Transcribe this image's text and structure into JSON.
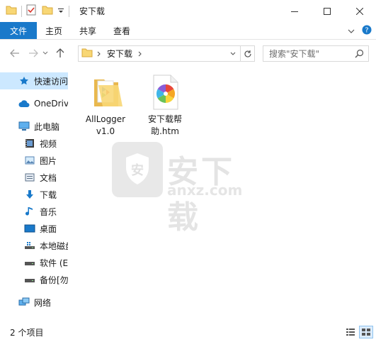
{
  "window": {
    "title": "安下载"
  },
  "ribbon": {
    "tabs": [
      {
        "label": "文件"
      },
      {
        "label": "主页"
      },
      {
        "label": "共享"
      },
      {
        "label": "查看"
      }
    ]
  },
  "address": {
    "path": "安下载",
    "search_placeholder": "搜索\"安下载\""
  },
  "sidebar": {
    "items": [
      {
        "label": "快速访问",
        "icon": "star-icon"
      },
      {
        "label": "OneDrive",
        "icon": "cloud-icon"
      },
      {
        "label": "此电脑",
        "icon": "computer-icon"
      },
      {
        "label": "视频",
        "icon": "video-icon"
      },
      {
        "label": "图片",
        "icon": "picture-icon"
      },
      {
        "label": "文档",
        "icon": "document-icon"
      },
      {
        "label": "下载",
        "icon": "download-icon"
      },
      {
        "label": "音乐",
        "icon": "music-icon"
      },
      {
        "label": "桌面",
        "icon": "desktop-icon"
      },
      {
        "label": "本地磁盘",
        "icon": "drive-icon"
      },
      {
        "label": "软件 (E",
        "icon": "drive-icon"
      },
      {
        "label": "备份[勿",
        "icon": "drive-icon"
      },
      {
        "label": "网络",
        "icon": "network-icon"
      }
    ]
  },
  "files": [
    {
      "name_line1": "AllLogger",
      "name_line2": "v1.0",
      "icon": "folder-icon"
    },
    {
      "name_line1": "安下载帮",
      "name_line2": "助.htm",
      "icon": "html-file-icon"
    }
  ],
  "watermark": {
    "cn": "安下载",
    "en": "anxz.com",
    "badge": "安"
  },
  "status": {
    "count": "2 个项目"
  },
  "colors": {
    "accent": "#1979ca",
    "selection": "#cce8ff",
    "folder": "#f8d775"
  }
}
